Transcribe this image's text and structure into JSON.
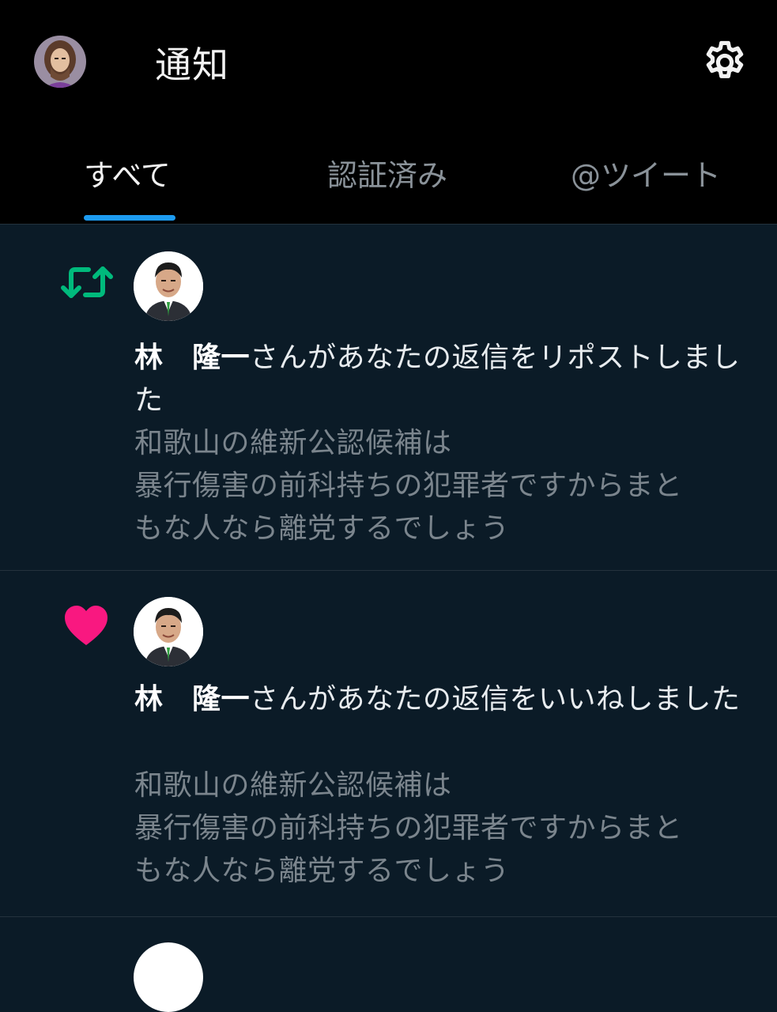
{
  "header": {
    "title": "通知"
  },
  "tabs": [
    {
      "label": "すべて",
      "active": true
    },
    {
      "label": "認証済み",
      "active": false
    },
    {
      "label": "@ツイート",
      "active": false
    }
  ],
  "notifications": [
    {
      "type": "repost",
      "icon": "repost-icon",
      "actor": "林　隆一",
      "action": "さんがあなたの返信をリポストしました",
      "quoted_lines": [
        "和歌山の維新公認候補は",
        "暴行傷害の前科持ちの犯罪者ですからまと",
        "もな人なら離党するでしょう"
      ]
    },
    {
      "type": "like",
      "icon": "heart-icon",
      "actor": "林　隆一",
      "action": "さんがあなたの返信をいいねしました",
      "quoted_lines": [
        "和歌山の維新公認候補は",
        "暴行傷害の前科持ちの犯罪者ですからまと",
        "もな人なら離党するでしょう"
      ]
    }
  ],
  "colors": {
    "background": "#0b1b27",
    "header_background": "#000000",
    "accent": "#1d9bf0",
    "repost_green": "#00ba7c",
    "like_pink": "#f91880",
    "muted_text": "#7b858d"
  }
}
